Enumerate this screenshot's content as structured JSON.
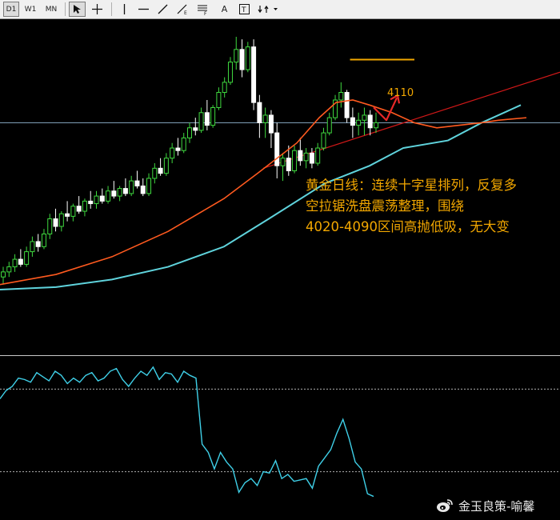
{
  "toolbar": {
    "periods": [
      "D1",
      "W1",
      "MN"
    ],
    "active_period": "D1",
    "tools": [
      {
        "name": "cursor-icon",
        "pressed": true
      },
      {
        "name": "crosshair-icon",
        "pressed": false
      },
      {
        "name": "horizontal-line-icon",
        "pressed": false
      },
      {
        "name": "trendline-icon",
        "pressed": false
      },
      {
        "name": "fibonacci-icon",
        "pressed": false
      },
      {
        "name": "channel-icon",
        "pressed": false
      },
      {
        "name": "text-icon",
        "label": "A",
        "pressed": false
      },
      {
        "name": "text-label-icon",
        "pressed": false
      },
      {
        "name": "arrows-icon",
        "pressed": false
      }
    ]
  },
  "annotation": {
    "lines": [
      "黄金日线：连续十字星排列，反复多",
      "空拉锯洗盘震荡整理，围绕",
      "4020-4090区间高抛低吸，无大变"
    ]
  },
  "level_label": "4110",
  "watermark": {
    "text": "金玉良策-喻馨",
    "icon": "weibo-icon"
  },
  "colors": {
    "background": "#000000",
    "bull_candle": "#3fd93f",
    "bear_candle": "#ffffff",
    "ma_fast": "#ff5a1f",
    "ma_slow": "#5fd3dc",
    "trendline": "#d01818",
    "hline": "#7f9fb7",
    "annotation": "#f2a700",
    "indicator": "#3fd0e8",
    "arrow": "#e82828"
  },
  "chart_data": {
    "type": "candlestick",
    "candles": [
      {
        "o": 0.05,
        "h": 0.09,
        "l": 0.02,
        "c": 0.07
      },
      {
        "o": 0.07,
        "h": 0.11,
        "l": 0.05,
        "c": 0.09
      },
      {
        "o": 0.09,
        "h": 0.14,
        "l": 0.07,
        "c": 0.12
      },
      {
        "o": 0.12,
        "h": 0.16,
        "l": 0.09,
        "c": 0.1
      },
      {
        "o": 0.1,
        "h": 0.17,
        "l": 0.09,
        "c": 0.15
      },
      {
        "o": 0.15,
        "h": 0.21,
        "l": 0.13,
        "c": 0.19
      },
      {
        "o": 0.19,
        "h": 0.22,
        "l": 0.15,
        "c": 0.17
      },
      {
        "o": 0.17,
        "h": 0.24,
        "l": 0.16,
        "c": 0.22
      },
      {
        "o": 0.22,
        "h": 0.3,
        "l": 0.2,
        "c": 0.28
      },
      {
        "o": 0.28,
        "h": 0.32,
        "l": 0.23,
        "c": 0.25
      },
      {
        "o": 0.25,
        "h": 0.31,
        "l": 0.23,
        "c": 0.3
      },
      {
        "o": 0.3,
        "h": 0.35,
        "l": 0.27,
        "c": 0.29
      },
      {
        "o": 0.29,
        "h": 0.34,
        "l": 0.27,
        "c": 0.33
      },
      {
        "o": 0.33,
        "h": 0.37,
        "l": 0.3,
        "c": 0.31
      },
      {
        "o": 0.31,
        "h": 0.36,
        "l": 0.29,
        "c": 0.35
      },
      {
        "o": 0.35,
        "h": 0.39,
        "l": 0.32,
        "c": 0.34
      },
      {
        "o": 0.34,
        "h": 0.39,
        "l": 0.32,
        "c": 0.37
      },
      {
        "o": 0.37,
        "h": 0.4,
        "l": 0.34,
        "c": 0.35
      },
      {
        "o": 0.35,
        "h": 0.41,
        "l": 0.34,
        "c": 0.39
      },
      {
        "o": 0.39,
        "h": 0.43,
        "l": 0.36,
        "c": 0.37
      },
      {
        "o": 0.37,
        "h": 0.41,
        "l": 0.35,
        "c": 0.4
      },
      {
        "o": 0.4,
        "h": 0.44,
        "l": 0.37,
        "c": 0.38
      },
      {
        "o": 0.38,
        "h": 0.45,
        "l": 0.37,
        "c": 0.43
      },
      {
        "o": 0.43,
        "h": 0.47,
        "l": 0.4,
        "c": 0.41
      },
      {
        "o": 0.41,
        "h": 0.44,
        "l": 0.37,
        "c": 0.38
      },
      {
        "o": 0.38,
        "h": 0.46,
        "l": 0.37,
        "c": 0.44
      },
      {
        "o": 0.44,
        "h": 0.5,
        "l": 0.42,
        "c": 0.48
      },
      {
        "o": 0.48,
        "h": 0.52,
        "l": 0.45,
        "c": 0.46
      },
      {
        "o": 0.46,
        "h": 0.54,
        "l": 0.45,
        "c": 0.52
      },
      {
        "o": 0.52,
        "h": 0.58,
        "l": 0.5,
        "c": 0.56
      },
      {
        "o": 0.56,
        "h": 0.6,
        "l": 0.53,
        "c": 0.55
      },
      {
        "o": 0.55,
        "h": 0.62,
        "l": 0.54,
        "c": 0.6
      },
      {
        "o": 0.6,
        "h": 0.66,
        "l": 0.58,
        "c": 0.64
      },
      {
        "o": 0.64,
        "h": 0.68,
        "l": 0.61,
        "c": 0.63
      },
      {
        "o": 0.63,
        "h": 0.72,
        "l": 0.62,
        "c": 0.7
      },
      {
        "o": 0.7,
        "h": 0.75,
        "l": 0.63,
        "c": 0.65
      },
      {
        "o": 0.65,
        "h": 0.73,
        "l": 0.64,
        "c": 0.72
      },
      {
        "o": 0.72,
        "h": 0.8,
        "l": 0.71,
        "c": 0.78
      },
      {
        "o": 0.78,
        "h": 0.84,
        "l": 0.76,
        "c": 0.82
      },
      {
        "o": 0.82,
        "h": 0.92,
        "l": 0.81,
        "c": 0.9
      },
      {
        "o": 0.9,
        "h": 1.0,
        "l": 0.87,
        "c": 0.95
      },
      {
        "o": 0.95,
        "h": 0.99,
        "l": 0.84,
        "c": 0.87
      },
      {
        "o": 0.87,
        "h": 0.98,
        "l": 0.86,
        "c": 0.96
      },
      {
        "o": 0.96,
        "h": 0.99,
        "l": 0.71,
        "c": 0.74
      },
      {
        "o": 0.74,
        "h": 0.77,
        "l": 0.6,
        "c": 0.66
      },
      {
        "o": 0.66,
        "h": 0.72,
        "l": 0.6,
        "c": 0.69
      },
      {
        "o": 0.69,
        "h": 0.71,
        "l": 0.56,
        "c": 0.62
      },
      {
        "o": 0.62,
        "h": 0.66,
        "l": 0.44,
        "c": 0.49
      },
      {
        "o": 0.49,
        "h": 0.54,
        "l": 0.43,
        "c": 0.52
      },
      {
        "o": 0.52,
        "h": 0.57,
        "l": 0.45,
        "c": 0.47
      },
      {
        "o": 0.47,
        "h": 0.57,
        "l": 0.46,
        "c": 0.55
      },
      {
        "o": 0.55,
        "h": 0.6,
        "l": 0.49,
        "c": 0.51
      },
      {
        "o": 0.51,
        "h": 0.56,
        "l": 0.48,
        "c": 0.54
      },
      {
        "o": 0.54,
        "h": 0.56,
        "l": 0.48,
        "c": 0.5
      },
      {
        "o": 0.5,
        "h": 0.58,
        "l": 0.49,
        "c": 0.56
      },
      {
        "o": 0.56,
        "h": 0.64,
        "l": 0.55,
        "c": 0.62
      },
      {
        "o": 0.62,
        "h": 0.7,
        "l": 0.61,
        "c": 0.68
      },
      {
        "o": 0.68,
        "h": 0.77,
        "l": 0.67,
        "c": 0.75
      },
      {
        "o": 0.75,
        "h": 0.82,
        "l": 0.72,
        "c": 0.78
      },
      {
        "o": 0.78,
        "h": 0.79,
        "l": 0.66,
        "c": 0.68
      },
      {
        "o": 0.68,
        "h": 0.72,
        "l": 0.6,
        "c": 0.65
      },
      {
        "o": 0.65,
        "h": 0.7,
        "l": 0.61,
        "c": 0.67
      },
      {
        "o": 0.67,
        "h": 0.72,
        "l": 0.61,
        "c": 0.69
      },
      {
        "o": 0.69,
        "h": 0.71,
        "l": 0.61,
        "c": 0.64
      },
      {
        "o": 0.64,
        "h": 0.7,
        "l": 0.62,
        "c": 0.66
      }
    ],
    "ma_fast_ref": [
      [
        0,
        0.02
      ],
      [
        0.1,
        0.06
      ],
      [
        0.2,
        0.13
      ],
      [
        0.3,
        0.23
      ],
      [
        0.4,
        0.36
      ],
      [
        0.46,
        0.46
      ],
      [
        0.53,
        0.58
      ],
      [
        0.57,
        0.68
      ],
      [
        0.6,
        0.74
      ],
      [
        0.63,
        0.75
      ],
      [
        0.66,
        0.73
      ],
      [
        0.7,
        0.7
      ],
      [
        0.74,
        0.66
      ],
      [
        0.78,
        0.64
      ],
      [
        0.82,
        0.65
      ],
      [
        0.86,
        0.66
      ],
      [
        0.89,
        0.67
      ],
      [
        0.94,
        0.68
      ]
    ],
    "ma_slow_ref": [
      [
        0,
        0.0
      ],
      [
        0.1,
        0.01
      ],
      [
        0.2,
        0.04
      ],
      [
        0.3,
        0.09
      ],
      [
        0.4,
        0.17
      ],
      [
        0.48,
        0.28
      ],
      [
        0.58,
        0.42
      ],
      [
        0.66,
        0.49
      ],
      [
        0.72,
        0.56
      ],
      [
        0.8,
        0.59
      ],
      [
        0.86,
        0.66
      ],
      [
        0.93,
        0.73
      ]
    ],
    "trendline_ref": [
      [
        0.47,
        0.48
      ],
      [
        1.0,
        0.86
      ]
    ],
    "hline_ref": 0.66,
    "level_4110_ref": [
      0.625,
      0.91,
      0.74
    ],
    "indicator": {
      "type": "line",
      "levels": [
        80,
        20
      ],
      "values": [
        73,
        79,
        82,
        88,
        87,
        85,
        92,
        89,
        86,
        93,
        90,
        84,
        88,
        85,
        90,
        92,
        86,
        88,
        93,
        95,
        87,
        82,
        88,
        93,
        90,
        96,
        87,
        92,
        91,
        85,
        93,
        90,
        88,
        40,
        34,
        22,
        34,
        27,
        22,
        5,
        12,
        15,
        10,
        20,
        19,
        28,
        15,
        18,
        13,
        14,
        15,
        8,
        24,
        30,
        36,
        48,
        58,
        44,
        27,
        22,
        4,
        2
      ]
    }
  }
}
